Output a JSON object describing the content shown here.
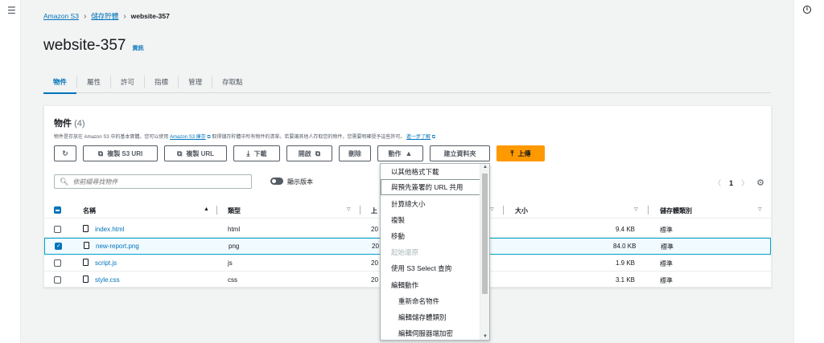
{
  "breadcrumb": {
    "s3": "Amazon S3",
    "buckets": "儲存貯體",
    "current": "website-357"
  },
  "page": {
    "title": "website-357",
    "info": "資訊"
  },
  "tabs": [
    "物件",
    "屬性",
    "許可",
    "指標",
    "管理",
    "存取點"
  ],
  "panel": {
    "title": "物件",
    "count": "(4)",
    "desc_1": "物件是存放在 Amazon S3 中的基本實體。您可以使用",
    "desc_link": "Amazon S3 庫存",
    "desc_2": "取得儲存貯體中所有物件的清單。若要讓其他人存取您的物件，您需要明確授予這些許可。",
    "desc_link2": "進一步了解"
  },
  "toolbar": {
    "refresh": "",
    "copy_s3_uri": "複製 S3 URI",
    "copy_url": "複製 URL",
    "download": "下載",
    "open": "開啟",
    "delete": "刪除",
    "actions": "動作",
    "create_folder": "建立資料夾",
    "upload": "上傳"
  },
  "search": {
    "placeholder": "依前綴尋找物件"
  },
  "versions_label": "顯示版本",
  "pager": {
    "page": "1"
  },
  "columns": {
    "name": "名稱",
    "type": "類型",
    "modified": "上",
    "size": "大小",
    "storage": "儲存體類別"
  },
  "rows": [
    {
      "name": "index.html",
      "type": "html",
      "modified": "20",
      "size": "9.4 KB",
      "storage": "標準",
      "checked": false
    },
    {
      "name": "new-report.png",
      "type": "png",
      "modified": "20",
      "size": "84.0 KB",
      "storage": "標準",
      "checked": true
    },
    {
      "name": "script.js",
      "type": "js",
      "modified": "20",
      "size": "1.9 KB",
      "storage": "標準",
      "checked": false
    },
    {
      "name": "style.css",
      "type": "css",
      "modified": "20",
      "size": "3.1 KB",
      "storage": "標準",
      "checked": false
    }
  ],
  "actions_menu": [
    {
      "label": "以其他格式下載"
    },
    {
      "label": "與預先簽署的 URL 共用"
    },
    {
      "label": "計算總大小"
    },
    {
      "label": "複製"
    },
    {
      "label": "移動"
    },
    {
      "label": "起始還原"
    },
    {
      "label": "使用 S3 Select 查詢"
    },
    {
      "label": "編輯動作"
    },
    {
      "label": "重新命名物件"
    },
    {
      "label": "編輯儲存體類別"
    },
    {
      "label": "編輯伺服器端加密"
    }
  ],
  "colors": {
    "link": "#0073bb",
    "primary": "#ff9900",
    "selected_border": "#00a1c9"
  }
}
